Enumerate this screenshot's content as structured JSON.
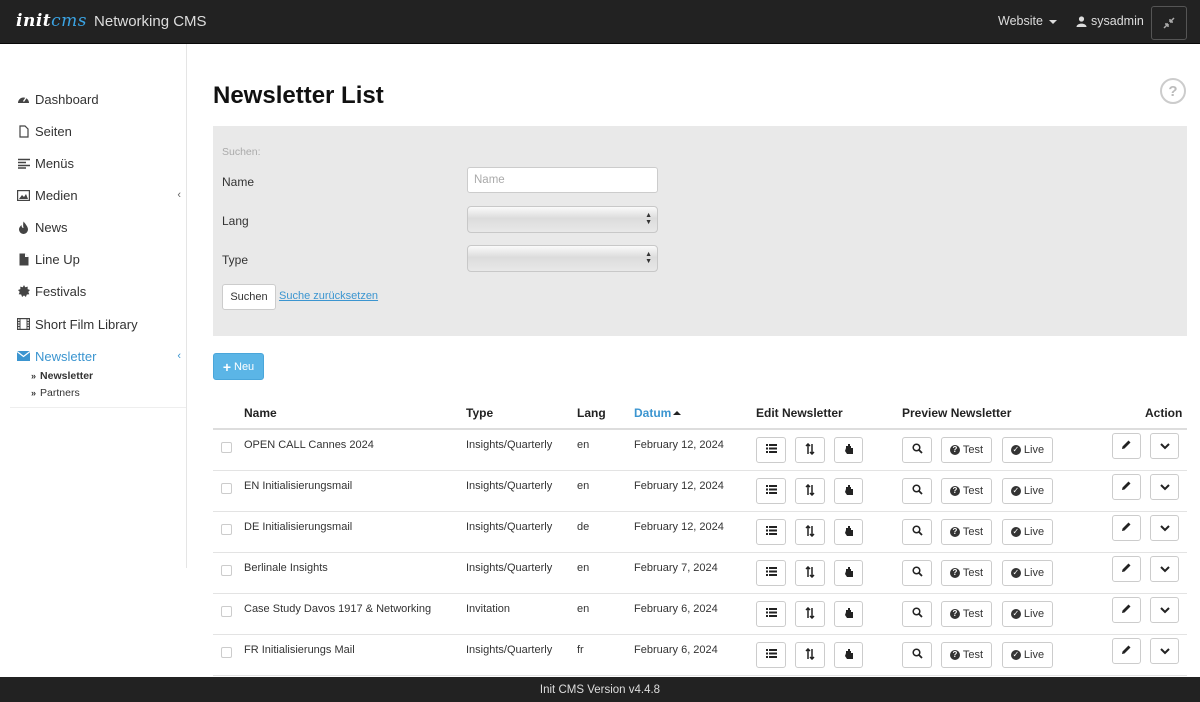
{
  "topbar": {
    "brand_prefix": "init",
    "brand_accent": "cms",
    "brand_subtitle": "Networking CMS",
    "website_menu": "Website",
    "user_menu": "sysadmin"
  },
  "sidebar": {
    "items": [
      {
        "label": "Dashboard",
        "icon": "dashboard-icon"
      },
      {
        "label": "Seiten",
        "icon": "file-icon"
      },
      {
        "label": "Menüs",
        "icon": "menu-lines-icon"
      },
      {
        "label": "Medien",
        "icon": "image-icon"
      },
      {
        "label": "News",
        "icon": "fire-icon"
      },
      {
        "label": "Line Up",
        "icon": "document-icon"
      },
      {
        "label": "Festivals",
        "icon": "certificate-icon"
      },
      {
        "label": "Short Film Library",
        "icon": "film-icon"
      },
      {
        "label": "Newsletter",
        "icon": "envelope-icon"
      }
    ],
    "subitems": [
      {
        "label": "Newsletter",
        "active": true
      },
      {
        "label": "Partners",
        "active": false
      }
    ]
  },
  "page": {
    "title": "Newsletter List"
  },
  "filter": {
    "legend": "Suchen:",
    "name_label": "Name",
    "name_placeholder": "Name",
    "lang_label": "Lang",
    "lang_value": "",
    "type_label": "Type",
    "type_value": "",
    "search_button": "Suchen",
    "reset_link": "Suche zurücksetzen"
  },
  "new_button": "Neu",
  "table": {
    "headers": {
      "name": "Name",
      "type": "Type",
      "lang": "Lang",
      "date": "Datum",
      "edit": "Edit Newsletter",
      "preview": "Preview Newsletter",
      "action": "Action"
    },
    "test_label": "Test",
    "live_label": "Live",
    "rows": [
      {
        "name": "OPEN CALL Cannes 2024",
        "type": "Insights/Quarterly",
        "lang": "en",
        "date": "February 12, 2024"
      },
      {
        "name": "EN Initialisierungsmail",
        "type": "Insights/Quarterly",
        "lang": "en",
        "date": "February 12, 2024"
      },
      {
        "name": "DE Initialisierungsmail",
        "type": "Insights/Quarterly",
        "lang": "de",
        "date": "February 12, 2024"
      },
      {
        "name": "Berlinale Insights",
        "type": "Insights/Quarterly",
        "lang": "en",
        "date": "February 7, 2024"
      },
      {
        "name": "Case Study Davos 1917 & Networking",
        "type": "Invitation",
        "lang": "en",
        "date": "February 6, 2024"
      },
      {
        "name": "FR Initialisierungs Mail",
        "type": "Insights/Quarterly",
        "lang": "fr",
        "date": "February 6, 2024"
      }
    ]
  },
  "footer": "Init CMS Version v4.4.8",
  "colors": {
    "accent": "#3b95d0",
    "new_button": "#5bb5e6",
    "topbar": "#222222"
  }
}
